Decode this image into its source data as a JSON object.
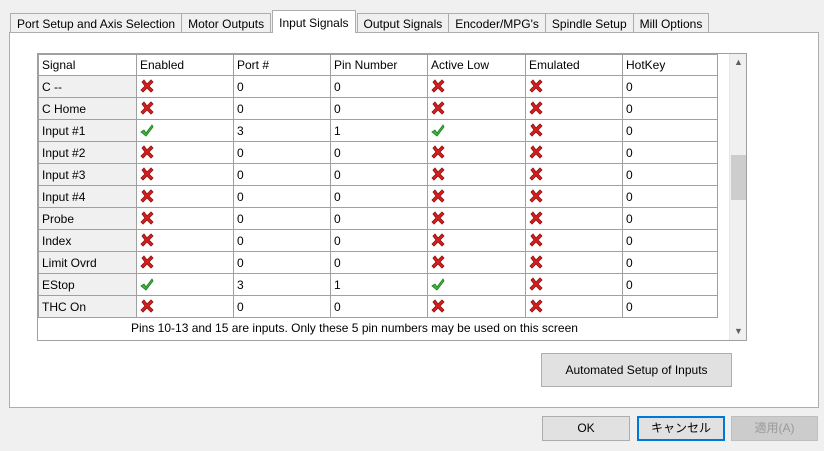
{
  "tabs": [
    {
      "label": "Port Setup and Axis Selection",
      "active": false
    },
    {
      "label": "Motor Outputs",
      "active": false
    },
    {
      "label": "Input Signals",
      "active": true
    },
    {
      "label": "Output Signals",
      "active": false
    },
    {
      "label": "Encoder/MPG's",
      "active": false
    },
    {
      "label": "Spindle Setup",
      "active": false
    },
    {
      "label": "Mill Options",
      "active": false
    }
  ],
  "table": {
    "columns": [
      "Signal",
      "Enabled",
      "Port #",
      "Pin Number",
      "Active Low",
      "Emulated",
      "HotKey"
    ],
    "rows": [
      {
        "signal": "C --",
        "enabled": false,
        "port": "0",
        "pin": "0",
        "active_low": false,
        "emulated": false,
        "hotkey": "0"
      },
      {
        "signal": "C Home",
        "enabled": false,
        "port": "0",
        "pin": "0",
        "active_low": false,
        "emulated": false,
        "hotkey": "0"
      },
      {
        "signal": "Input #1",
        "enabled": true,
        "port": "3",
        "pin": "1",
        "active_low": true,
        "emulated": false,
        "hotkey": "0"
      },
      {
        "signal": "Input #2",
        "enabled": false,
        "port": "0",
        "pin": "0",
        "active_low": false,
        "emulated": false,
        "hotkey": "0"
      },
      {
        "signal": "Input #3",
        "enabled": false,
        "port": "0",
        "pin": "0",
        "active_low": false,
        "emulated": false,
        "hotkey": "0"
      },
      {
        "signal": "Input #4",
        "enabled": false,
        "port": "0",
        "pin": "0",
        "active_low": false,
        "emulated": false,
        "hotkey": "0"
      },
      {
        "signal": "Probe",
        "enabled": false,
        "port": "0",
        "pin": "0",
        "active_low": false,
        "emulated": false,
        "hotkey": "0"
      },
      {
        "signal": "Index",
        "enabled": false,
        "port": "0",
        "pin": "0",
        "active_low": false,
        "emulated": false,
        "hotkey": "0"
      },
      {
        "signal": "Limit Ovrd",
        "enabled": false,
        "port": "0",
        "pin": "0",
        "active_low": false,
        "emulated": false,
        "hotkey": "0"
      },
      {
        "signal": "EStop",
        "enabled": true,
        "port": "3",
        "pin": "1",
        "active_low": true,
        "emulated": false,
        "hotkey": "0"
      },
      {
        "signal": "THC On",
        "enabled": false,
        "port": "0",
        "pin": "0",
        "active_low": false,
        "emulated": false,
        "hotkey": "0"
      }
    ]
  },
  "info_text": "Pins 10-13 and 15 are inputs. Only these 5 pin numbers may be used on this screen",
  "buttons": {
    "automated": "Automated Setup of Inputs",
    "ok": "OK",
    "cancel": "キャンセル",
    "apply": "適用(A)"
  },
  "icons": {
    "true": "green-check-icon",
    "false": "red-x-icon"
  },
  "colors": {
    "check": "#3cb83c",
    "cross": "#d81e1e",
    "focus": "#0078d7"
  }
}
